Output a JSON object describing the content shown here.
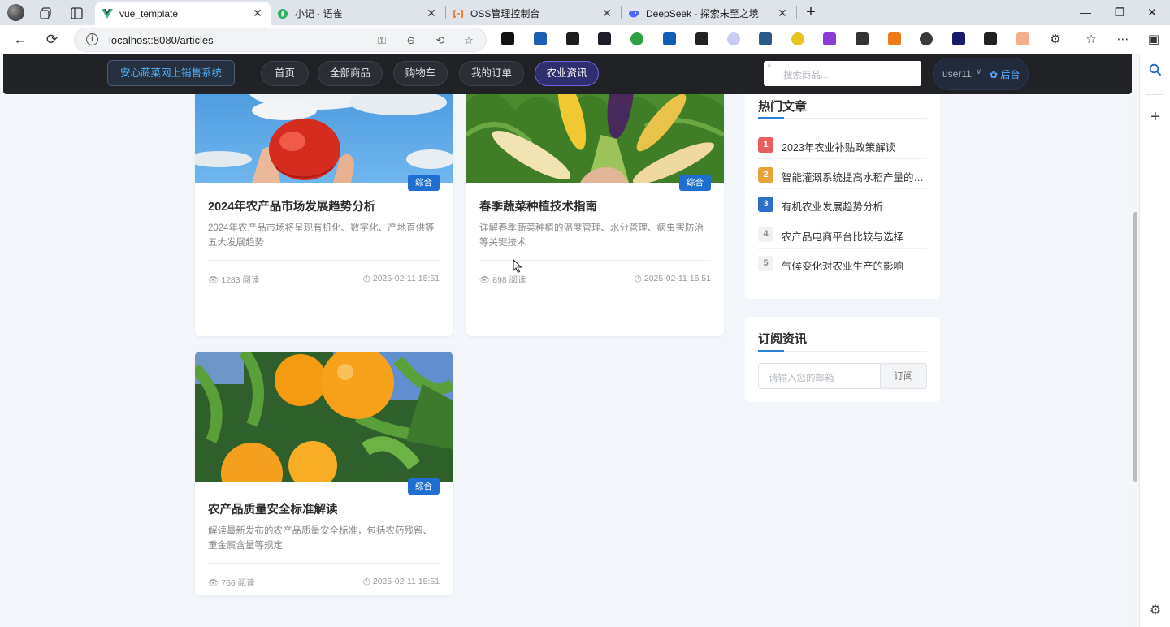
{
  "browser": {
    "tabs": [
      {
        "title": "vue_template",
        "active": true
      },
      {
        "title": "小记 · 语雀",
        "active": false
      },
      {
        "title": "OSS管理控制台",
        "active": false
      },
      {
        "title": "DeepSeek - 探索未至之境",
        "active": false
      }
    ],
    "new_tab": "+",
    "url": "localhost:8080/articles",
    "window_controls": [
      "—",
      "❐",
      "✕"
    ]
  },
  "navbar": {
    "brand": "安心蔬菜网上销售系统",
    "items": [
      {
        "label": "首页"
      },
      {
        "label": "全部商品"
      },
      {
        "label": "购物车"
      },
      {
        "label": "我的订单"
      },
      {
        "label": "农业资讯",
        "active": true
      }
    ],
    "search_placeholder": "搜索商品...",
    "username": "user11",
    "admin_label": "后台"
  },
  "articles": [
    {
      "title": "2024年农产品市场发展趋势分析",
      "tag": "综合",
      "description": "2024年农产品市场将呈现有机化、数字化、产地直供等五大发展趋势",
      "views": "1283 阅读",
      "date": "2025-02-11 15:51",
      "image": "tomato-sky"
    },
    {
      "title": "春季蔬菜种植技术指南",
      "tag": "综合",
      "description": "详解春季蔬菜种植的温度管理、水分管理、病虫害防治等关键技术",
      "views": "898 阅读",
      "date": "2025-02-11 15:51",
      "image": "corn-field"
    },
    {
      "title": "农产品质量安全标准解读",
      "tag": "综合",
      "description": "解读最新发布的农产品质量安全标准，包括农药残留、重金属含量等规定",
      "views": "766 阅读",
      "date": "2025-02-11 15:51",
      "image": "orange-tree"
    }
  ],
  "hot_articles": {
    "title": "热门文章",
    "items": [
      {
        "rank": "1",
        "title": "2023年农业补贴政策解读",
        "color": "#e85d5d"
      },
      {
        "rank": "2",
        "title": "智能灌溉系统提高水稻产量的研究",
        "color": "#e8a23a"
      },
      {
        "rank": "3",
        "title": "有机农业发展趋势分析",
        "color": "#2b6fc9"
      },
      {
        "rank": "4",
        "title": "农产品电商平台比较与选择",
        "color": "#f1f2f4"
      },
      {
        "rank": "5",
        "title": "气候变化对农业生产的影响",
        "color": "#f1f2f4"
      }
    ]
  },
  "subscribe": {
    "title": "订阅资讯",
    "placeholder": "请输入您的邮箱",
    "button": "订阅"
  }
}
